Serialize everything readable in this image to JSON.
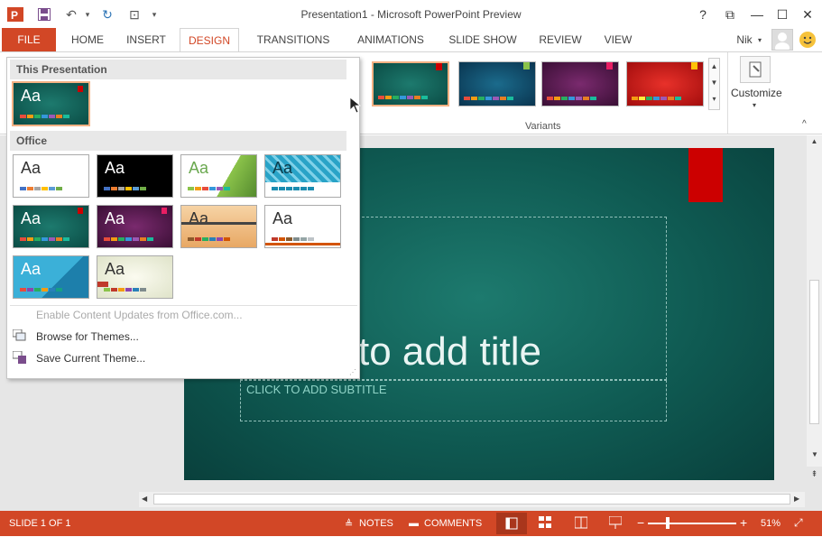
{
  "window": {
    "title": "Presentation1 - Microsoft PowerPoint Preview",
    "user": "Nik"
  },
  "tabs": [
    "FILE",
    "HOME",
    "INSERT",
    "DESIGN",
    "TRANSITIONS",
    "ANIMATIONS",
    "SLIDE SHOW",
    "REVIEW",
    "VIEW"
  ],
  "ribbon": {
    "variants_label": "Variants",
    "customize_label": "Customize"
  },
  "panel": {
    "this_presentation": "This Presentation",
    "office": "Office",
    "theme_text": "Aa",
    "menu": {
      "enable_updates": "Enable Content Updates from Office.com...",
      "browse": "Browse for Themes...",
      "save": "Save Current Theme..."
    }
  },
  "slide": {
    "title_placeholder": "to add title",
    "subtitle_placeholder": "CLICK TO ADD SUBTITLE"
  },
  "status": {
    "slide_info": "SLIDE 1 OF 1",
    "notes": "NOTES",
    "comments": "COMMENTS",
    "zoom": "51%"
  },
  "colors": {
    "accent": "#d24726",
    "slide_bg": "#0f5a52"
  }
}
